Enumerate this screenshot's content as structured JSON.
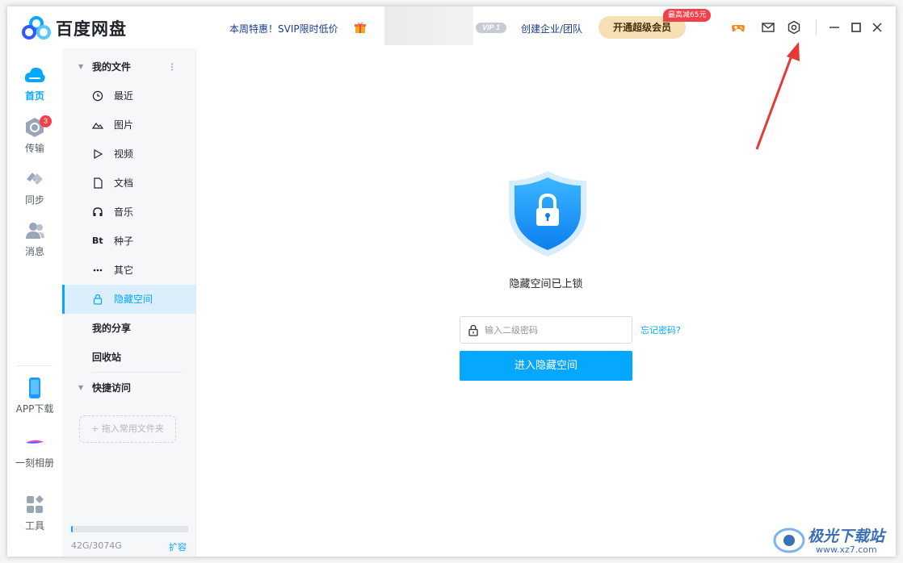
{
  "app": {
    "name": "百度网盘"
  },
  "header": {
    "promo": "本周特惠！SVIP限时低价",
    "vip_badge": "VIP 1",
    "enterprise_link": "创建企业/团队",
    "svip_button": "开通超级会员",
    "discount_badge": "最高减65元"
  },
  "leftnav": {
    "items": [
      {
        "label": "首页",
        "icon": "cloud-home-icon"
      },
      {
        "label": "传输",
        "icon": "transfer-icon",
        "badge": "3"
      },
      {
        "label": "同步",
        "icon": "sync-icon"
      },
      {
        "label": "消息",
        "icon": "users-icon"
      },
      {
        "label": "APP下载",
        "icon": "phone-icon"
      },
      {
        "label": "一刻相册",
        "icon": "album-icon"
      },
      {
        "label": "工具",
        "icon": "tools-icon"
      }
    ]
  },
  "files": {
    "header": "我的文件",
    "items": [
      {
        "label": "最近",
        "icon": "clock-icon"
      },
      {
        "label": "图片",
        "icon": "image-icon"
      },
      {
        "label": "视频",
        "icon": "play-icon"
      },
      {
        "label": "文档",
        "icon": "document-icon"
      },
      {
        "label": "音乐",
        "icon": "headphones-icon"
      },
      {
        "label": "种子",
        "icon": "Bt"
      },
      {
        "label": "其它",
        "icon": "more-dots-icon"
      },
      {
        "label": "隐藏空间",
        "icon": "lock-icon"
      }
    ],
    "share": "我的分享",
    "recycle": "回收站",
    "quick_access": "快捷访问",
    "drag_hint": "+ 拖入常用文件夹",
    "storage": {
      "text": "42G/3074G",
      "used_fraction": 0.014
    },
    "expand": "扩容"
  },
  "hidden_space": {
    "title": "隐藏空间已上锁",
    "password_placeholder": "输入二级密码",
    "password_value": "",
    "forgot_link": "忘记密码?",
    "enter_button": "进入隐藏空间"
  },
  "watermark": {
    "name": "极光下载站",
    "url": "www.xz7.com"
  },
  "colors": {
    "accent": "#06a7ff",
    "svip": "#f7dfb5",
    "badge": "#f2404b",
    "annotation": "#e53935"
  }
}
